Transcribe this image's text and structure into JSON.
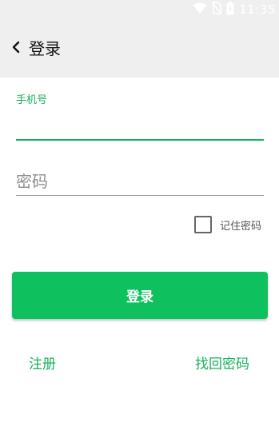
{
  "status_bar": {
    "time": "11:35",
    "icons": [
      "wifi-icon",
      "no-sim-icon",
      "battery-icon"
    ]
  },
  "toolbar": {
    "back_icon": "chevron-left-icon",
    "title": "登录"
  },
  "form": {
    "phone_label": "手机号",
    "phone_value": "",
    "password_placeholder": "密码",
    "password_value": "",
    "remember_label": "记住密码",
    "remember_checked": false
  },
  "actions": {
    "login_label": "登录",
    "register_label": "注册",
    "forgot_label": "找回密码"
  },
  "colors": {
    "accent": "#17b15c",
    "button": "#0fc15e",
    "bar_background": "#efefef"
  }
}
